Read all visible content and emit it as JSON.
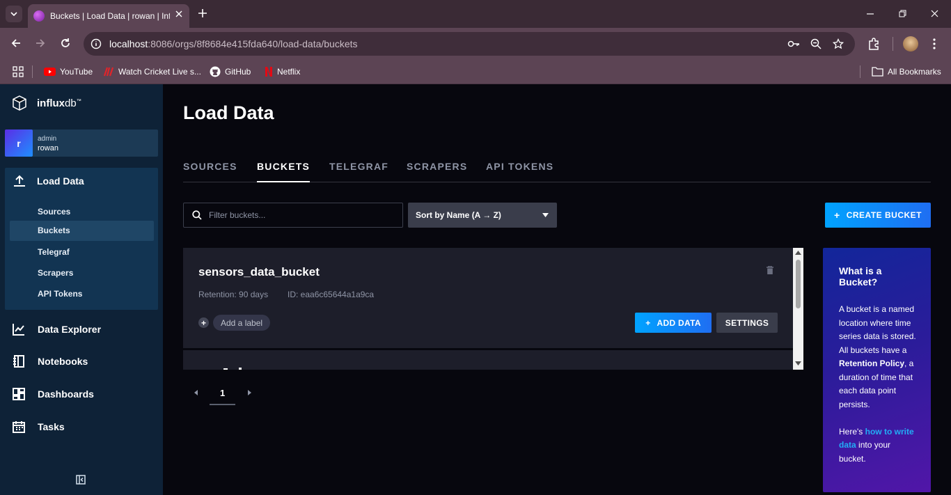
{
  "browser": {
    "tab_title": "Buckets | Load Data | rowan | InfluxDB",
    "url_host": "localhost",
    "url_rest": ":8086/orgs/8f8684e415fda640/load-data/buckets",
    "bookmarks": [
      "YouTube",
      "Watch Cricket Live s...",
      "GitHub",
      "Netflix"
    ],
    "all_bookmarks": "All Bookmarks"
  },
  "sidebar": {
    "logo_main": "influx",
    "logo_db": "db",
    "logo_tm": "™",
    "user": {
      "initial": "r",
      "role": "admin",
      "org": "rowan"
    },
    "load_data": {
      "label": "Load Data",
      "subitems": [
        "Sources",
        "Buckets",
        "Telegraf",
        "Scrapers",
        "API Tokens"
      ],
      "active_subitem": "Buckets"
    },
    "nav": [
      "Data Explorer",
      "Notebooks",
      "Dashboards",
      "Tasks"
    ]
  },
  "main": {
    "title": "Load Data",
    "tabs": [
      "SOURCES",
      "BUCKETS",
      "TELEGRAF",
      "SCRAPERS",
      "API TOKENS"
    ],
    "active_tab": "BUCKETS",
    "filter_placeholder": "Filter buckets...",
    "sort_label": "Sort by Name (A → Z)",
    "create_label": "CREATE BUCKET",
    "buckets": [
      {
        "name": "sensors_data_bucket",
        "retention": "Retention: 90 days",
        "id": "ID: eaa6c65644a1a9ca",
        "add_label": "Add a label",
        "add_data": "ADD DATA",
        "settings": "SETTINGS"
      }
    ],
    "page": "1"
  },
  "help": {
    "title": "What is a Bucket?",
    "p1_a": "A bucket is a named location where time series data is stored. All buckets have a ",
    "p1_bold": "Retention Policy",
    "p1_b": ", a duration of time that each data point persists.",
    "p2_a": "Here's ",
    "p2_link": "how to write data",
    "p2_b": " into your bucket."
  },
  "colors": {
    "sidebar_bg": "#0e2237",
    "main_bg": "#07070e",
    "accent_blue": "#00a3ff",
    "card_bg": "#1d1e2a",
    "browser_chrome": "#5c4454"
  }
}
